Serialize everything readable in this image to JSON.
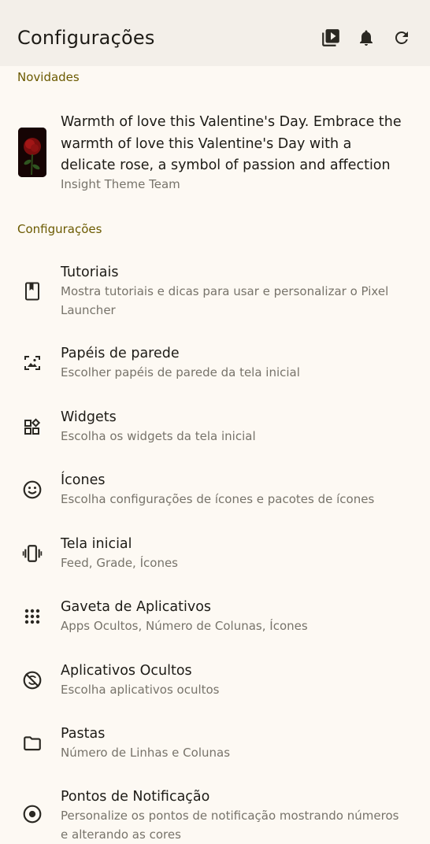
{
  "header": {
    "title": "Configurações",
    "actions": [
      {
        "name": "play-library-icon"
      },
      {
        "name": "bell-icon"
      },
      {
        "name": "refresh-icon"
      }
    ]
  },
  "news": {
    "section_label": "Novidades",
    "title": "Warmth of love this Valentine's Day. Embrace the warmth of love this Valentine's Day with a delicate rose, a symbol of passion and affection",
    "author": "Insight Theme Team"
  },
  "settings": {
    "section_label": "Configurações",
    "items": [
      {
        "icon": "book-icon",
        "title": "Tutoriais",
        "subtitle": "Mostra tutoriais e dicas para usar e personalizar o Pixel Launcher"
      },
      {
        "icon": "wallpaper-icon",
        "title": "Papéis de parede",
        "subtitle": "Escolher papéis de parede da tela inicial"
      },
      {
        "icon": "widgets-icon",
        "title": "Widgets",
        "subtitle": "Escolha os widgets da tela inicial"
      },
      {
        "icon": "smiley-icon",
        "title": "Ícones",
        "subtitle": "Escolha configurações de ícones e pacotes de ícones"
      },
      {
        "icon": "home-screen-icon",
        "title": "Tela inicial",
        "subtitle": "Feed, Grade, Ícones"
      },
      {
        "icon": "app-grid-icon",
        "title": "Gaveta de Aplicativos",
        "subtitle": "Apps Ocultos, Número de Colunas, Ícones"
      },
      {
        "icon": "hidden-apps-icon",
        "title": "Aplicativos Ocultos",
        "subtitle": "Escolha aplicativos ocultos"
      },
      {
        "icon": "folder-icon",
        "title": "Pastas",
        "subtitle": "Número de Linhas e Colunas"
      },
      {
        "icon": "notification-dot-icon",
        "title": "Pontos de Notificação",
        "subtitle": "Personalize os pontos de notificação mostrando números e alterando as cores"
      }
    ]
  },
  "colors": {
    "background": "#FDF9F3",
    "toolbar": "#F3EFE9",
    "accent_label": "#6B5A00",
    "text_primary": "#1D1B16",
    "text_secondary": "#77736A"
  }
}
